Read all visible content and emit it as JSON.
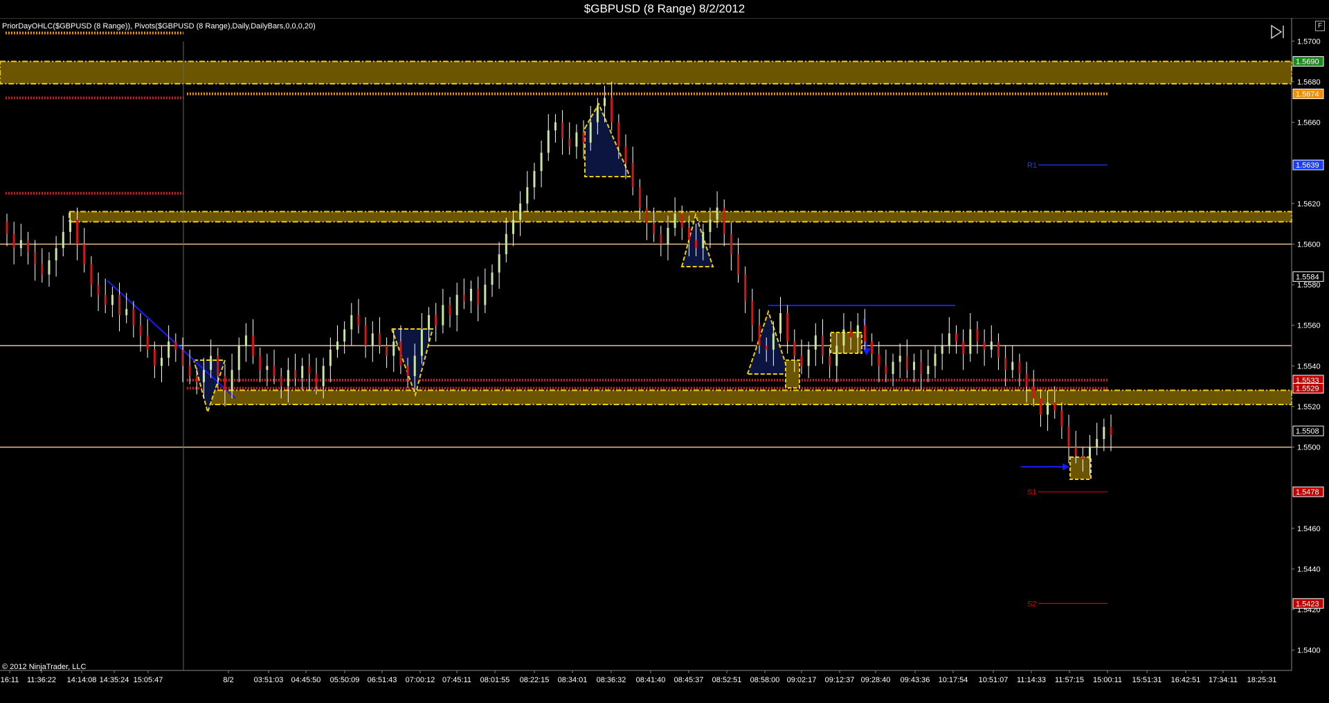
{
  "title": "$GBPUSD (8 Range)  8/2/2012",
  "indicator_label": "PriorDayOHLC($GBPUSD (8 Range)), Pivots($GBPUSD (8 Range),Daily,DailyBars,0,0,0,20)",
  "copyright": "© 2012 NinjaTrader, LLC",
  "f_button": "F",
  "colors": {
    "background": "#000000",
    "up_bar": "#c8e6a0",
    "down_bar": "#d01818",
    "wick": "#ffffff",
    "zone_fill": "#6b5500",
    "zone_border": "#f0d000",
    "pivot_line": "#e8c090",
    "blue": "#1a1aff",
    "resistance_label": "#1a3cff",
    "support_label": "#e00000"
  },
  "chart_data": {
    "type": "candlestick",
    "ylim": [
      1.539,
      1.571
    ],
    "y_ticks": [
      "1.5700",
      "1.5680",
      "1.5660",
      "1.5620",
      "1.5600",
      "1.5580",
      "1.5560",
      "1.5540",
      "1.5520",
      "1.5500",
      "1.5460",
      "1.5440",
      "1.5420",
      "1.5400"
    ],
    "x_ticks": [
      "16:11",
      "11:36:22",
      "14:14:08",
      "14:35:24",
      "15:05:47",
      "8/2",
      "03:51:03",
      "04:45:50",
      "05:50:09",
      "06:51:43",
      "07:00:12",
      "07:45:11",
      "08:01:55",
      "08:22:15",
      "08:34:01",
      "08:36:32",
      "08:41:40",
      "08:45:37",
      "08:52:51",
      "08:58:00",
      "09:02:17",
      "09:12:37",
      "09:28:40",
      "09:43:36",
      "10:17:54",
      "10:51:07",
      "11:14:33",
      "11:57:15",
      "15:00:11",
      "15:51:31",
      "16:42:51",
      "17:34:11",
      "18:25:31"
    ],
    "price_flags": [
      {
        "label": "1.5690",
        "color": "#1a8a1a"
      },
      {
        "label": "1.5674",
        "color": "#f09000"
      },
      {
        "label": "1.5639",
        "color": "#1a3cff"
      },
      {
        "label": "1.5584",
        "color": "#000000"
      },
      {
        "label": "1.5533",
        "color": "#c00000"
      },
      {
        "label": "1.5529",
        "color": "#c00000"
      },
      {
        "label": "1.5508",
        "color": "#000000"
      },
      {
        "label": "1.5478",
        "color": "#c00000"
      },
      {
        "label": "1.5423",
        "color": "#c00000"
      }
    ],
    "pivot_labels": [
      {
        "label": "R1",
        "price": 1.5639,
        "color": "#1a3cff"
      },
      {
        "label": "S1",
        "price": 1.5478,
        "color": "#e00000"
      },
      {
        "label": "S2",
        "price": 1.5423,
        "color": "#e00000"
      }
    ],
    "horizontal_levels": [
      {
        "price": 1.56,
        "color": "#e8c090"
      },
      {
        "price": 1.555,
        "color": "#e8c090"
      },
      {
        "price": 1.55,
        "color": "#e8c090"
      }
    ],
    "zones": [
      {
        "top": 1.569,
        "bottom": 1.5679
      },
      {
        "top": 1.5616,
        "bottom": 1.5611
      },
      {
        "top": 1.5528,
        "bottom": 1.5521
      }
    ],
    "closes": [
      1.5605,
      1.5598,
      1.5602,
      1.5596,
      1.559,
      1.5585,
      1.5592,
      1.5598,
      1.5606,
      1.5612,
      1.56,
      1.559,
      1.558,
      1.5575,
      1.557,
      1.5575,
      1.5565,
      1.5568,
      1.556,
      1.5555,
      1.5548,
      1.554,
      1.5544,
      1.5552,
      1.5548,
      1.554,
      1.5535,
      1.5532,
      1.5538,
      1.5545,
      1.5535,
      1.5528,
      1.5538,
      1.555,
      1.5555,
      1.5545,
      1.5538,
      1.554,
      1.5535,
      1.553,
      1.5538,
      1.5534,
      1.554,
      1.5536,
      1.553,
      1.554,
      1.5548,
      1.5552,
      1.5558,
      1.5565,
      1.556,
      1.555,
      1.5556,
      1.555,
      1.5545,
      1.5552,
      1.554,
      1.5535,
      1.5545,
      1.5558,
      1.5565,
      1.556,
      1.557,
      1.5565,
      1.5575,
      1.5572,
      1.5578,
      1.557,
      1.558,
      1.5586,
      1.5595,
      1.5605,
      1.5612,
      1.562,
      1.5628,
      1.5636,
      1.5645,
      1.5656,
      1.566,
      1.5652,
      1.5648,
      1.5655,
      1.565,
      1.566,
      1.5668,
      1.5672,
      1.566,
      1.5648,
      1.564,
      1.5628,
      1.5618,
      1.561,
      1.5605,
      1.56,
      1.5608,
      1.5615,
      1.5608,
      1.5602,
      1.5598,
      1.5606,
      1.5612,
      1.5618,
      1.5605,
      1.5595,
      1.5585,
      1.5572,
      1.556,
      1.555,
      1.5548,
      1.5556,
      1.5566,
      1.5552,
      1.5545,
      1.554,
      1.5548,
      1.5555,
      1.5545,
      1.554,
      1.555,
      1.5558,
      1.5554,
      1.556,
      1.5552,
      1.5546,
      1.554,
      1.5536,
      1.5542,
      1.5545,
      1.5538,
      1.5542,
      1.5536,
      1.554,
      1.5546,
      1.555,
      1.5556,
      1.5552,
      1.5546,
      1.5558,
      1.5552,
      1.5548,
      1.5552,
      1.5544,
      1.5538,
      1.5542,
      1.5536,
      1.553,
      1.5524,
      1.5516,
      1.5522,
      1.5518,
      1.551,
      1.55,
      1.5496,
      1.5494,
      1.55,
      1.5504,
      1.551,
      1.5506
    ]
  }
}
